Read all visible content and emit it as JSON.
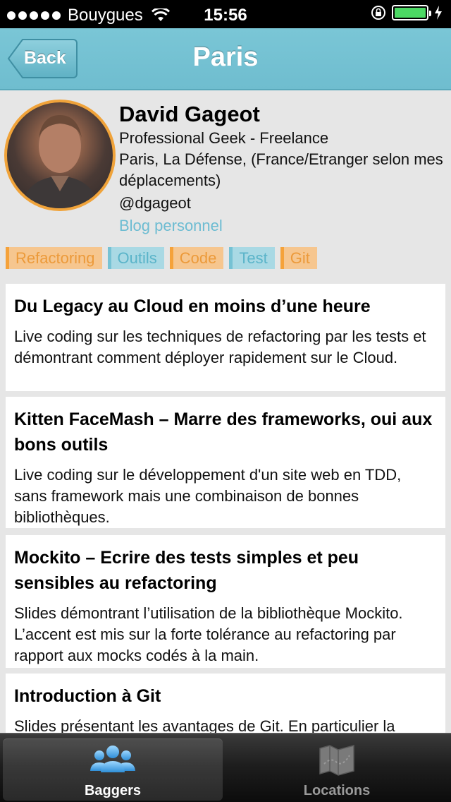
{
  "status_bar": {
    "carrier": "Bouygues",
    "time": "15:56",
    "battery_color": "#4cd964"
  },
  "navbar": {
    "back_label": "Back",
    "title": "Paris",
    "bar_color": "#74c1d3"
  },
  "profile": {
    "name": "David Gageot",
    "title": "Professional Geek - Freelance",
    "location": "Paris, La Défense, (France/Etranger selon mes déplacements)",
    "handle": "@dgageot",
    "blog_link": "Blog personnel",
    "avatar_icon": "avatar-photo"
  },
  "tags": [
    {
      "label": "Refactoring",
      "color": "orange"
    },
    {
      "label": "Outils",
      "color": "blue"
    },
    {
      "label": "Code",
      "color": "orange"
    },
    {
      "label": "Test",
      "color": "blue"
    },
    {
      "label": "Git",
      "color": "orange"
    }
  ],
  "talks": [
    {
      "title": "Du Legacy au Cloud en moins d’une heure",
      "description": "Live coding sur les techniques de refactoring par les tests et démontrant comment déployer rapidement sur le Cloud."
    },
    {
      "title": "Kitten FaceMash – Marre des frameworks, oui aux bons outils",
      "description": "Live coding sur le développement d'un site web en TDD, sans framework mais une combinaison de bonnes bibliothèques."
    },
    {
      "title": "Mockito – Ecrire des tests simples et peu sensibles au refactoring",
      "description": "Slides démontrant l’utilisation de la bibliothèque Mockito. L’accent est mis sur la forte tolérance au refactoring par rapport aux mocks codés à la main."
    },
    {
      "title": "Introduction à Git",
      "description": "Slides présentant les avantages de Git. En particulier la"
    }
  ],
  "tabbar": {
    "tabs": [
      {
        "label": "Baggers",
        "icon": "people-icon",
        "active": true
      },
      {
        "label": "Locations",
        "icon": "map-icon",
        "active": false
      }
    ]
  }
}
